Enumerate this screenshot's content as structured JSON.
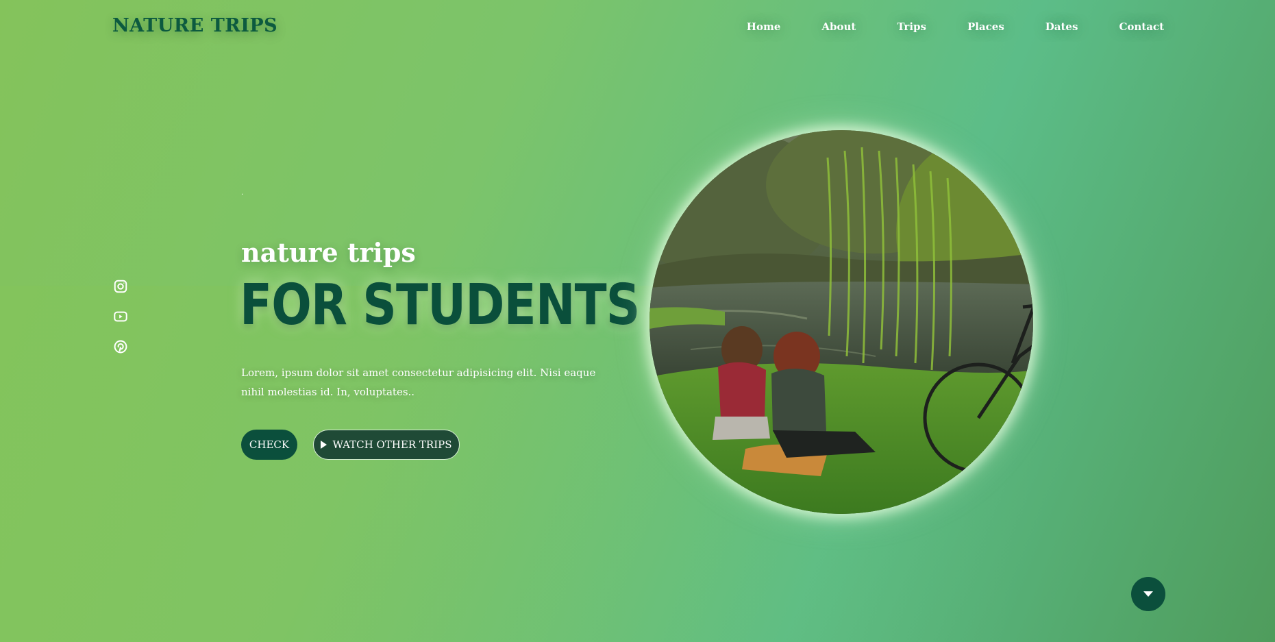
{
  "header": {
    "logo": "NATURE TRIPS",
    "nav": [
      "Home",
      "About",
      "Trips",
      "Places",
      "Dates",
      "Contact"
    ]
  },
  "hero": {
    "dot": ".",
    "subtitle": "nature trips",
    "title": "FOR STUDENTS",
    "description": "Lorem, ipsum dolor sit amet consectetur adipisicing elit. Nisi eaque nihil molestias id. In, voluptates..",
    "primary_button": "CHECK",
    "secondary_button": "WATCH OTHER TRIPS"
  },
  "social_icons": [
    "instagram-icon",
    "youtube-icon",
    "pinterest-icon"
  ],
  "colors": {
    "accent_dark_green": "#0b4f3c",
    "background_light": "#84c35b",
    "background_teal": "#5cbd88",
    "text": "#ffffff"
  }
}
